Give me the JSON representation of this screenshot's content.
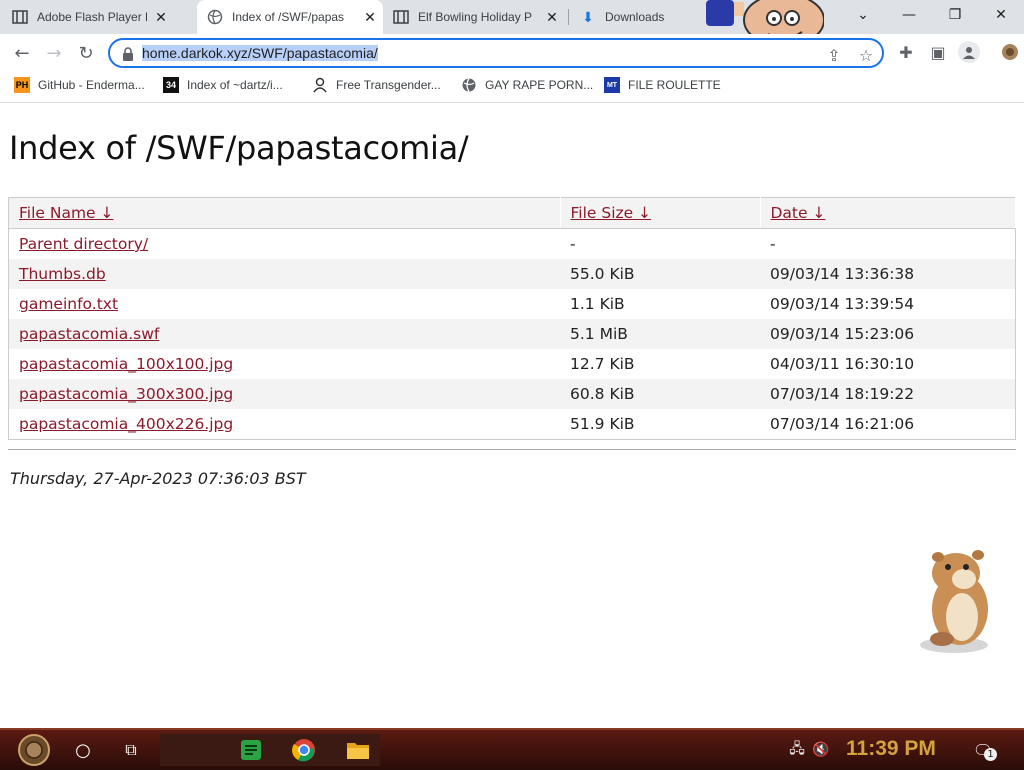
{
  "tabs": [
    {
      "title": "Adobe Flash Player Pr",
      "icon": "archive-icon"
    },
    {
      "title": "Index of /SWF/papas",
      "icon": "globe-icon"
    },
    {
      "title": "Elf Bowling Holiday P",
      "icon": "archive-icon"
    },
    {
      "title": "Downloads",
      "icon": "download-icon"
    }
  ],
  "toolbar": {
    "url": "home.darkok.xyz/SWF/papastacomia/"
  },
  "bookmarks": [
    {
      "label": "GitHub - Enderma...",
      "icon_text": "PH"
    },
    {
      "label": "Index of ~dartz/i...",
      "icon_text": "34"
    },
    {
      "label": "Free Transgender...",
      "icon_text": ""
    },
    {
      "label": "GAY RAPE PORN...",
      "icon_text": ""
    },
    {
      "label": "FILE ROULETTE",
      "icon_text": "MT"
    }
  ],
  "page": {
    "title": "Index of /SWF/papastacomia/",
    "headers": {
      "name": "File Name  ↓",
      "size": "File Size  ↓",
      "date": "Date  ↓"
    },
    "rows": [
      {
        "name": "Parent directory/",
        "size": "-",
        "date": "-"
      },
      {
        "name": "Thumbs.db",
        "size": "55.0 KiB",
        "date": "09/03/14 13:36:38"
      },
      {
        "name": "gameinfo.txt",
        "size": "1.1 KiB",
        "date": "09/03/14 13:39:54"
      },
      {
        "name": "papastacomia.swf",
        "size": "5.1 MiB",
        "date": "09/03/14 15:23:06"
      },
      {
        "name": "papastacomia_100x100.jpg",
        "size": "12.7 KiB",
        "date": "04/03/11 16:30:10"
      },
      {
        "name": "papastacomia_300x300.jpg",
        "size": "60.8 KiB",
        "date": "07/03/14 18:19:22"
      },
      {
        "name": "papastacomia_400x226.jpg",
        "size": "51.9 KiB",
        "date": "07/03/14 16:21:06"
      }
    ],
    "footer": "Thursday, 27-Apr-2023 07:36:03 BST"
  },
  "taskbar": {
    "clock": "11:39 PM",
    "notification_count": "1"
  }
}
